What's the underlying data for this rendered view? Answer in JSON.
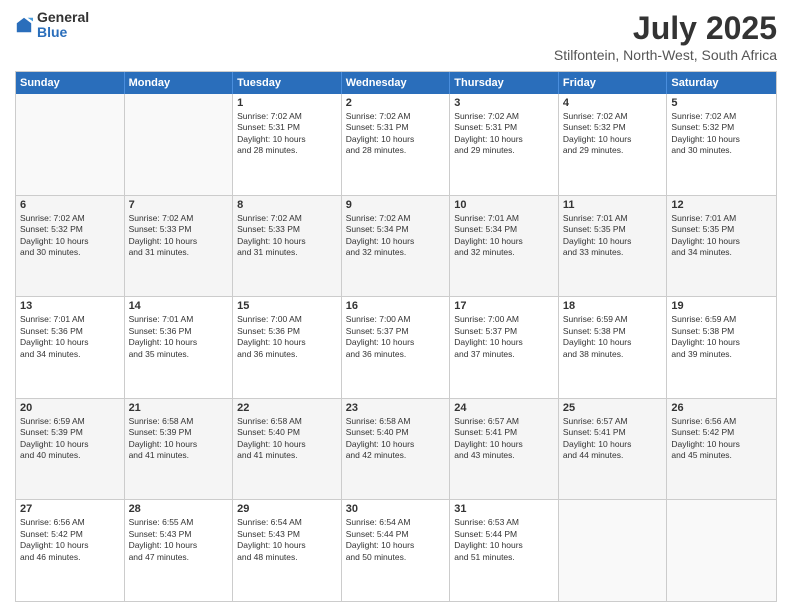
{
  "logo": {
    "general": "General",
    "blue": "Blue"
  },
  "title": "July 2025",
  "subtitle": "Stilfontein, North-West, South Africa",
  "header_days": [
    "Sunday",
    "Monday",
    "Tuesday",
    "Wednesday",
    "Thursday",
    "Friday",
    "Saturday"
  ],
  "rows": [
    {
      "alt": false,
      "cells": [
        {
          "empty": true,
          "day": "",
          "text": ""
        },
        {
          "empty": true,
          "day": "",
          "text": ""
        },
        {
          "empty": false,
          "day": "1",
          "text": "Sunrise: 7:02 AM\nSunset: 5:31 PM\nDaylight: 10 hours\nand 28 minutes."
        },
        {
          "empty": false,
          "day": "2",
          "text": "Sunrise: 7:02 AM\nSunset: 5:31 PM\nDaylight: 10 hours\nand 28 minutes."
        },
        {
          "empty": false,
          "day": "3",
          "text": "Sunrise: 7:02 AM\nSunset: 5:31 PM\nDaylight: 10 hours\nand 29 minutes."
        },
        {
          "empty": false,
          "day": "4",
          "text": "Sunrise: 7:02 AM\nSunset: 5:32 PM\nDaylight: 10 hours\nand 29 minutes."
        },
        {
          "empty": false,
          "day": "5",
          "text": "Sunrise: 7:02 AM\nSunset: 5:32 PM\nDaylight: 10 hours\nand 30 minutes."
        }
      ]
    },
    {
      "alt": true,
      "cells": [
        {
          "empty": false,
          "day": "6",
          "text": "Sunrise: 7:02 AM\nSunset: 5:32 PM\nDaylight: 10 hours\nand 30 minutes."
        },
        {
          "empty": false,
          "day": "7",
          "text": "Sunrise: 7:02 AM\nSunset: 5:33 PM\nDaylight: 10 hours\nand 31 minutes."
        },
        {
          "empty": false,
          "day": "8",
          "text": "Sunrise: 7:02 AM\nSunset: 5:33 PM\nDaylight: 10 hours\nand 31 minutes."
        },
        {
          "empty": false,
          "day": "9",
          "text": "Sunrise: 7:02 AM\nSunset: 5:34 PM\nDaylight: 10 hours\nand 32 minutes."
        },
        {
          "empty": false,
          "day": "10",
          "text": "Sunrise: 7:01 AM\nSunset: 5:34 PM\nDaylight: 10 hours\nand 32 minutes."
        },
        {
          "empty": false,
          "day": "11",
          "text": "Sunrise: 7:01 AM\nSunset: 5:35 PM\nDaylight: 10 hours\nand 33 minutes."
        },
        {
          "empty": false,
          "day": "12",
          "text": "Sunrise: 7:01 AM\nSunset: 5:35 PM\nDaylight: 10 hours\nand 34 minutes."
        }
      ]
    },
    {
      "alt": false,
      "cells": [
        {
          "empty": false,
          "day": "13",
          "text": "Sunrise: 7:01 AM\nSunset: 5:36 PM\nDaylight: 10 hours\nand 34 minutes."
        },
        {
          "empty": false,
          "day": "14",
          "text": "Sunrise: 7:01 AM\nSunset: 5:36 PM\nDaylight: 10 hours\nand 35 minutes."
        },
        {
          "empty": false,
          "day": "15",
          "text": "Sunrise: 7:00 AM\nSunset: 5:36 PM\nDaylight: 10 hours\nand 36 minutes."
        },
        {
          "empty": false,
          "day": "16",
          "text": "Sunrise: 7:00 AM\nSunset: 5:37 PM\nDaylight: 10 hours\nand 36 minutes."
        },
        {
          "empty": false,
          "day": "17",
          "text": "Sunrise: 7:00 AM\nSunset: 5:37 PM\nDaylight: 10 hours\nand 37 minutes."
        },
        {
          "empty": false,
          "day": "18",
          "text": "Sunrise: 6:59 AM\nSunset: 5:38 PM\nDaylight: 10 hours\nand 38 minutes."
        },
        {
          "empty": false,
          "day": "19",
          "text": "Sunrise: 6:59 AM\nSunset: 5:38 PM\nDaylight: 10 hours\nand 39 minutes."
        }
      ]
    },
    {
      "alt": true,
      "cells": [
        {
          "empty": false,
          "day": "20",
          "text": "Sunrise: 6:59 AM\nSunset: 5:39 PM\nDaylight: 10 hours\nand 40 minutes."
        },
        {
          "empty": false,
          "day": "21",
          "text": "Sunrise: 6:58 AM\nSunset: 5:39 PM\nDaylight: 10 hours\nand 41 minutes."
        },
        {
          "empty": false,
          "day": "22",
          "text": "Sunrise: 6:58 AM\nSunset: 5:40 PM\nDaylight: 10 hours\nand 41 minutes."
        },
        {
          "empty": false,
          "day": "23",
          "text": "Sunrise: 6:58 AM\nSunset: 5:40 PM\nDaylight: 10 hours\nand 42 minutes."
        },
        {
          "empty": false,
          "day": "24",
          "text": "Sunrise: 6:57 AM\nSunset: 5:41 PM\nDaylight: 10 hours\nand 43 minutes."
        },
        {
          "empty": false,
          "day": "25",
          "text": "Sunrise: 6:57 AM\nSunset: 5:41 PM\nDaylight: 10 hours\nand 44 minutes."
        },
        {
          "empty": false,
          "day": "26",
          "text": "Sunrise: 6:56 AM\nSunset: 5:42 PM\nDaylight: 10 hours\nand 45 minutes."
        }
      ]
    },
    {
      "alt": false,
      "cells": [
        {
          "empty": false,
          "day": "27",
          "text": "Sunrise: 6:56 AM\nSunset: 5:42 PM\nDaylight: 10 hours\nand 46 minutes."
        },
        {
          "empty": false,
          "day": "28",
          "text": "Sunrise: 6:55 AM\nSunset: 5:43 PM\nDaylight: 10 hours\nand 47 minutes."
        },
        {
          "empty": false,
          "day": "29",
          "text": "Sunrise: 6:54 AM\nSunset: 5:43 PM\nDaylight: 10 hours\nand 48 minutes."
        },
        {
          "empty": false,
          "day": "30",
          "text": "Sunrise: 6:54 AM\nSunset: 5:44 PM\nDaylight: 10 hours\nand 50 minutes."
        },
        {
          "empty": false,
          "day": "31",
          "text": "Sunrise: 6:53 AM\nSunset: 5:44 PM\nDaylight: 10 hours\nand 51 minutes."
        },
        {
          "empty": true,
          "day": "",
          "text": ""
        },
        {
          "empty": true,
          "day": "",
          "text": ""
        }
      ]
    }
  ]
}
